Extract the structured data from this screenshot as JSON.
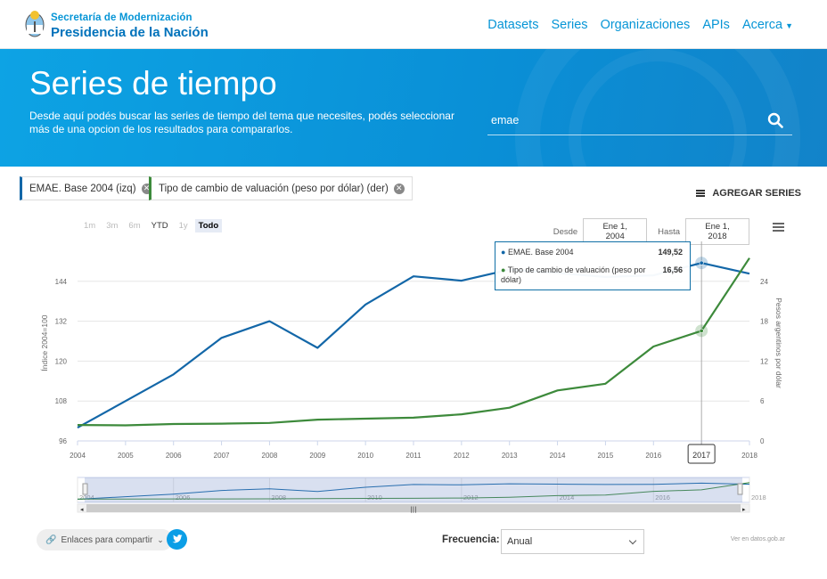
{
  "header": {
    "brand_line1": "Secretaría de Modernización",
    "brand_line2": "Presidencia de la Nación",
    "nav": [
      "Datasets",
      "Series",
      "Organizaciones",
      "APIs",
      "Acerca"
    ]
  },
  "hero": {
    "title": "Series de tiempo",
    "description": "Desde aquí podés buscar las series de tiempo del tema que necesites, podés seleccionar más de una opcion de los resultados para compararlos.",
    "search_value": "emae"
  },
  "selected_series": [
    {
      "label": "EMAE. Base 2004 (izq)",
      "color": "#1367a8"
    },
    {
      "label": "Tipo de cambio de valuación (peso por dólar) (der)",
      "color": "#3d8a3b"
    }
  ],
  "add_series_label": "AGREGAR SERIES",
  "range_buttons": [
    "1m",
    "3m",
    "6m",
    "YTD",
    "1y",
    "Todo"
  ],
  "range_selected": "Todo",
  "date_range": {
    "from_label": "Desde",
    "from": "Ene 1, 2004",
    "to_label": "Hasta",
    "to": "Ene 1, 2018"
  },
  "chart_data": {
    "type": "line",
    "x": [
      2004,
      2005,
      2006,
      2007,
      2008,
      2009,
      2010,
      2011,
      2012,
      2013,
      2014,
      2015,
      2016,
      2017,
      2018
    ],
    "x_ticks": [
      "2004",
      "2005",
      "2006",
      "2007",
      "2008",
      "2009",
      "2010",
      "2011",
      "2012",
      "2013",
      "2014",
      "2015",
      "2016",
      "2017",
      "2018"
    ],
    "series": [
      {
        "name": "EMAE. Base 2004",
        "axis": "left",
        "color": "#1367a8",
        "values": [
          100,
          108,
          116,
          127,
          132,
          124,
          137,
          145.5,
          144.2,
          147.5,
          146.5,
          145.3,
          145.8,
          149.52,
          146.3
        ]
      },
      {
        "name": "Tipo de cambio de valuación (peso por dólar)",
        "axis": "right",
        "color": "#3d8a3b",
        "values": [
          2.4,
          2.35,
          2.55,
          2.6,
          2.7,
          3.2,
          3.35,
          3.5,
          4.0,
          5.0,
          7.6,
          8.6,
          14.2,
          16.56,
          27.5
        ]
      }
    ],
    "ylabel_left": "Índice 2004=100",
    "ylabel_right": "Pesos argentinos por dólar",
    "y_left_ticks": [
      96,
      108,
      120,
      132,
      144
    ],
    "y_left_lim": [
      96,
      156
    ],
    "y_right_ticks": [
      0,
      6,
      12,
      18,
      24
    ],
    "y_right_lim": [
      0,
      30
    ],
    "hover_x": 2017,
    "navigator_ticks": [
      "2004",
      "2006",
      "2008",
      "2010",
      "2012",
      "2014",
      "2016",
      "2018"
    ],
    "grid": true
  },
  "tooltip": {
    "s1_name": "EMAE. Base 2004",
    "s1_value": "149,52",
    "s2_name": "Tipo de cambio de valuación (peso por dólar)",
    "s2_value": "16,56",
    "x_label": "2017"
  },
  "footer": {
    "share_label": "Enlaces para compartir",
    "frequency_label": "Frecuencia:",
    "frequency_value": "Anual",
    "source": "Ver en datos.gob.ar"
  },
  "colors": {
    "primary": "#0695d6",
    "emae": "#1367a8",
    "tc": "#3d8a3b"
  }
}
